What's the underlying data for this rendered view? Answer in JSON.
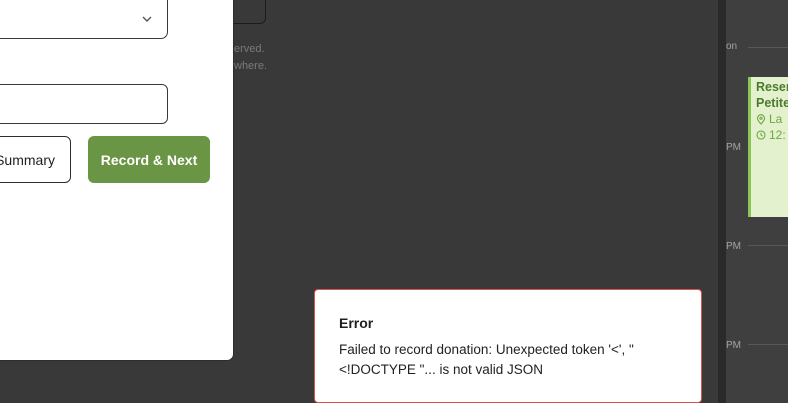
{
  "modal": {
    "summary_button_label": "Summary",
    "record_next_button_label": "Record & Next"
  },
  "background": {
    "line1_fragment": "erved.",
    "line2_fragment": "where."
  },
  "calendar": {
    "time_labels": [
      "on",
      "PM",
      "PM",
      "PM"
    ],
    "event": {
      "title_line1": "Reser",
      "title_line2": "Petite",
      "location": "La",
      "time": "12:"
    },
    "colors": {
      "event_bg": "#e3f1cf",
      "event_accent": "#8bc655",
      "event_text": "#4d7a2c"
    }
  },
  "toast": {
    "title": "Error",
    "message": "Failed to record donation: Unexpected token '<', \"<!DOCTYPE \"... is not valid JSON",
    "border_color": "#d9534f"
  },
  "colors": {
    "primary_button": "#699545",
    "overlay": "#393939"
  },
  "icons": [
    "chevron-down-icon",
    "map-pin-icon",
    "clock-icon"
  ]
}
